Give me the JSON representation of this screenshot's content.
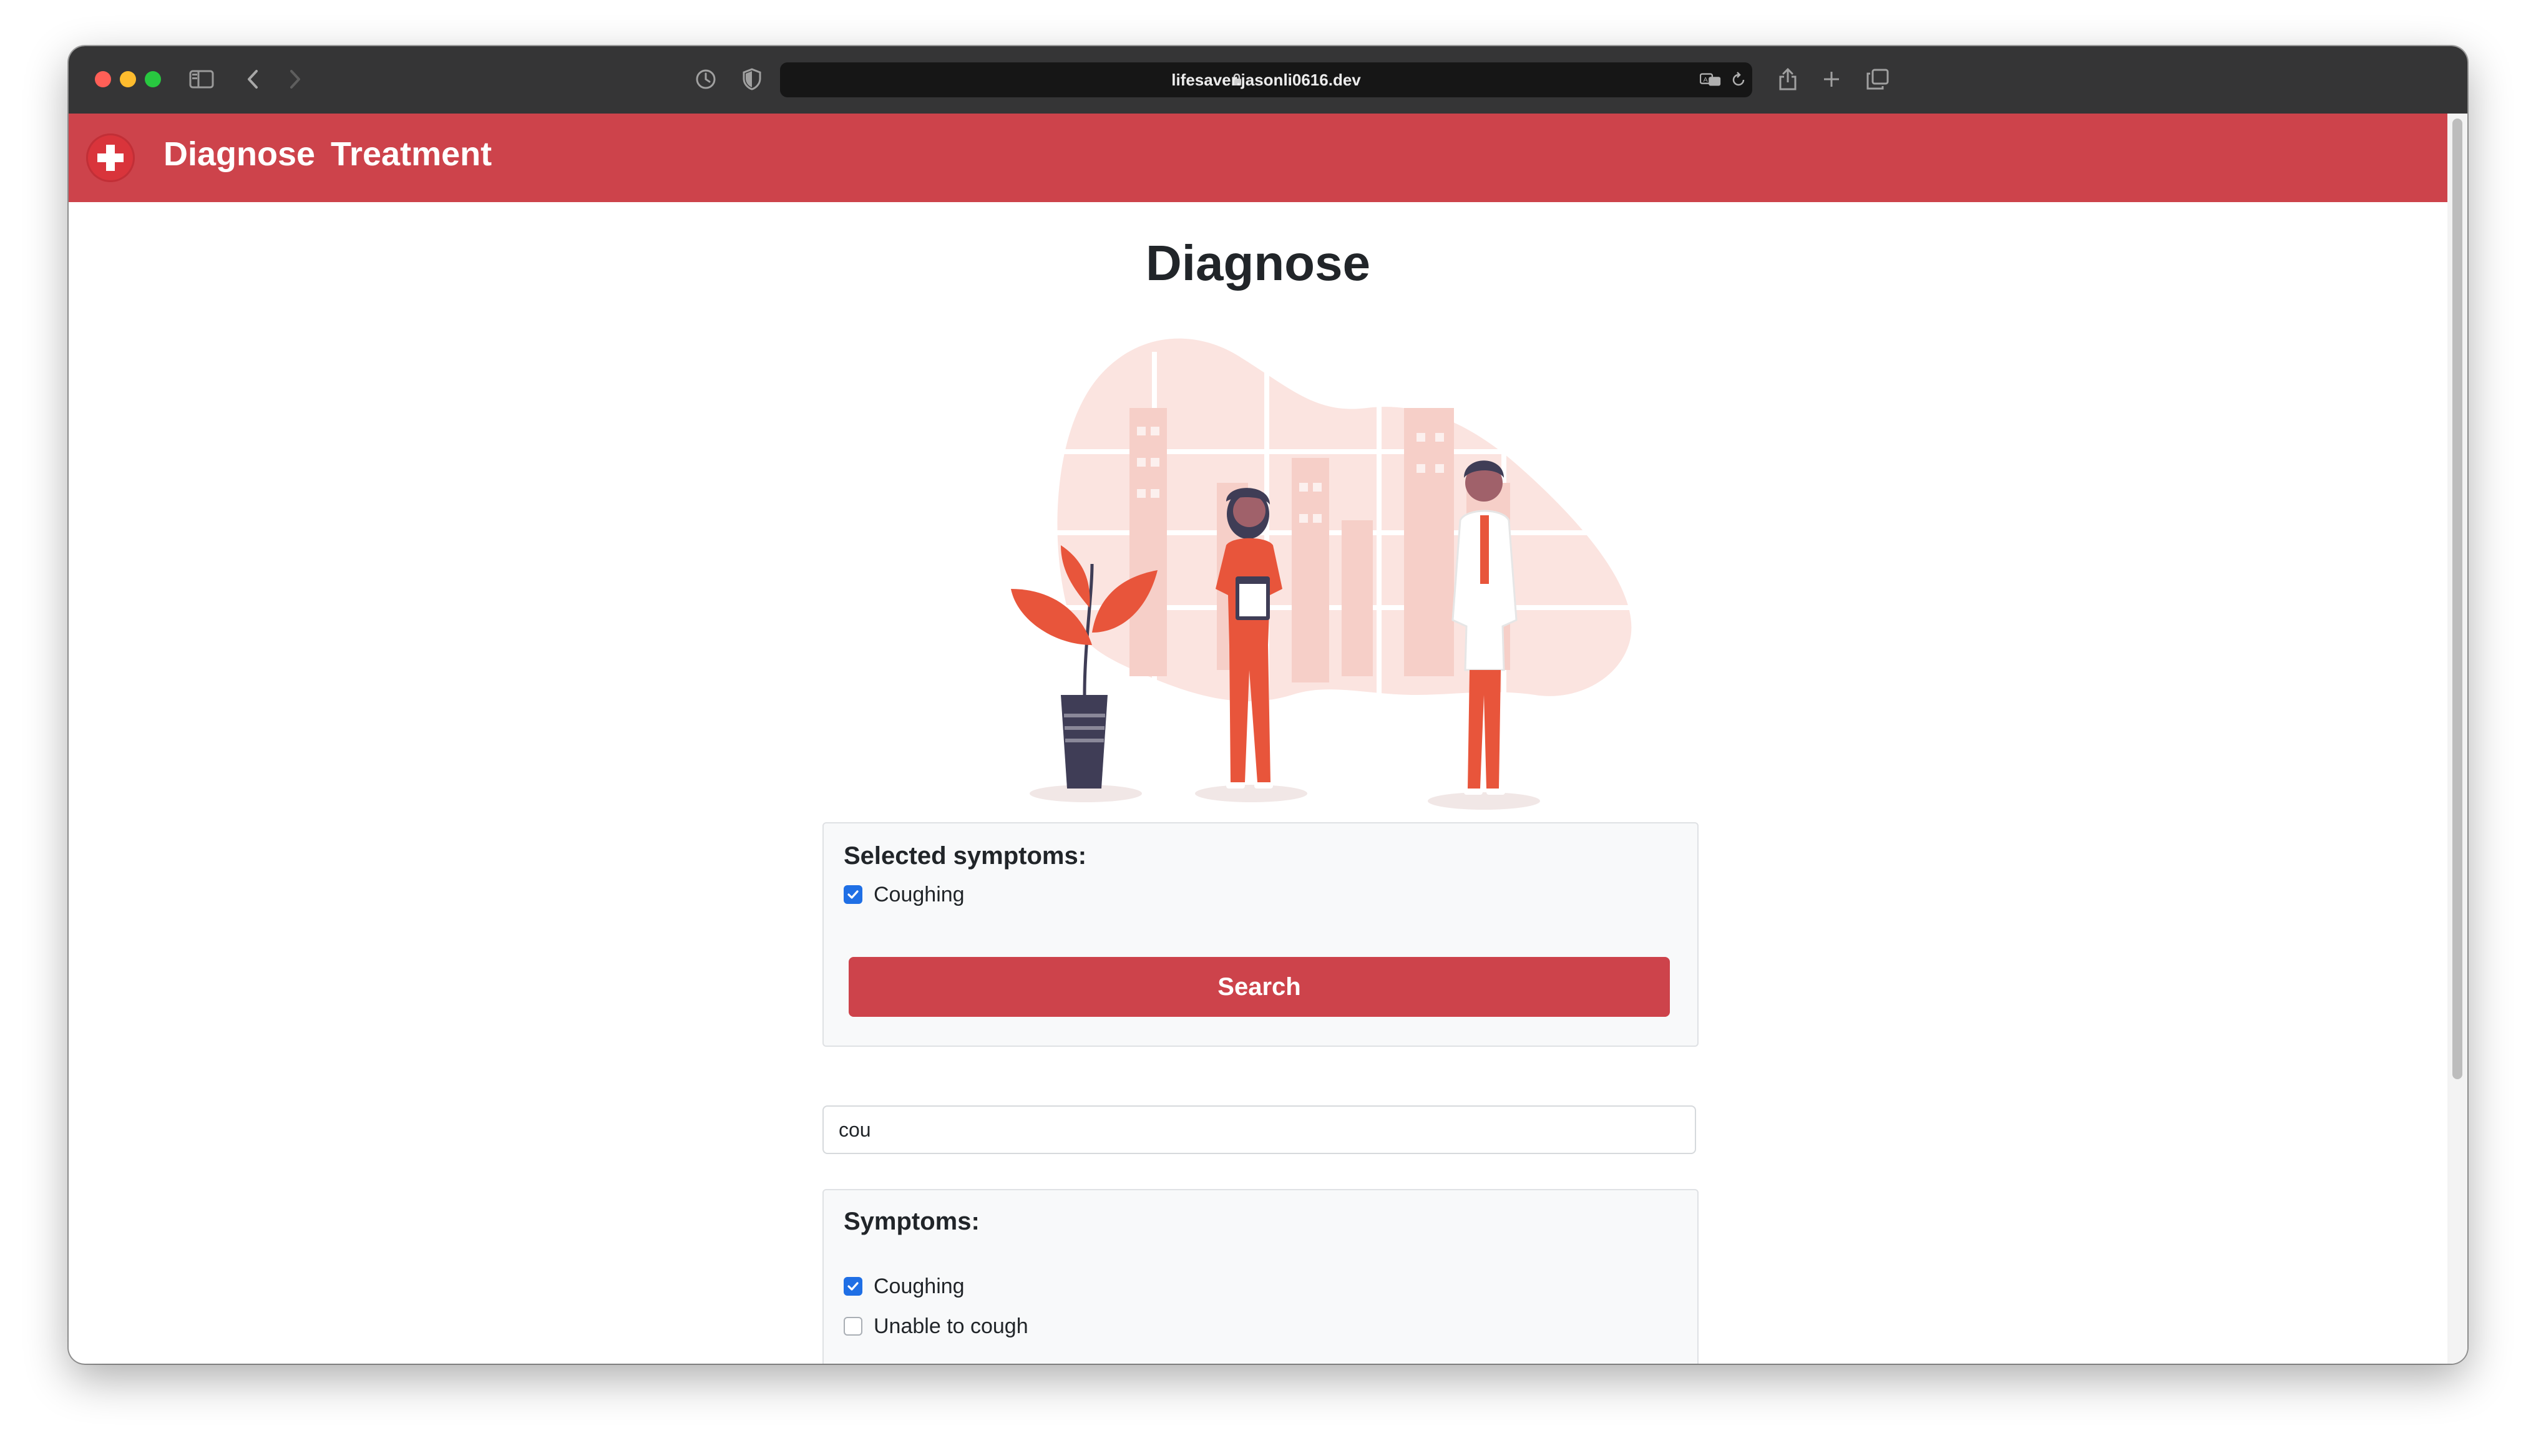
{
  "browser": {
    "url": "lifesaver.jasonli0616.dev"
  },
  "navbar": {
    "links": [
      {
        "label": "Diagnose"
      },
      {
        "label": "Treatment"
      }
    ]
  },
  "page": {
    "title": "Diagnose"
  },
  "selected_symptoms": {
    "heading": "Selected symptoms:",
    "items": [
      {
        "label": "Coughing",
        "checked": true
      }
    ],
    "search_button_label": "Search"
  },
  "filter": {
    "value": "cou"
  },
  "symptoms": {
    "heading": "Symptoms:",
    "items": [
      {
        "label": "Coughing",
        "checked": true
      },
      {
        "label": "Unable to cough",
        "checked": false
      }
    ]
  },
  "colors": {
    "brand": "#cd434b",
    "checkbox_checked": "#1f6fe5",
    "illustration_accent": "#e8553b",
    "illustration_dark": "#3f3d56"
  }
}
